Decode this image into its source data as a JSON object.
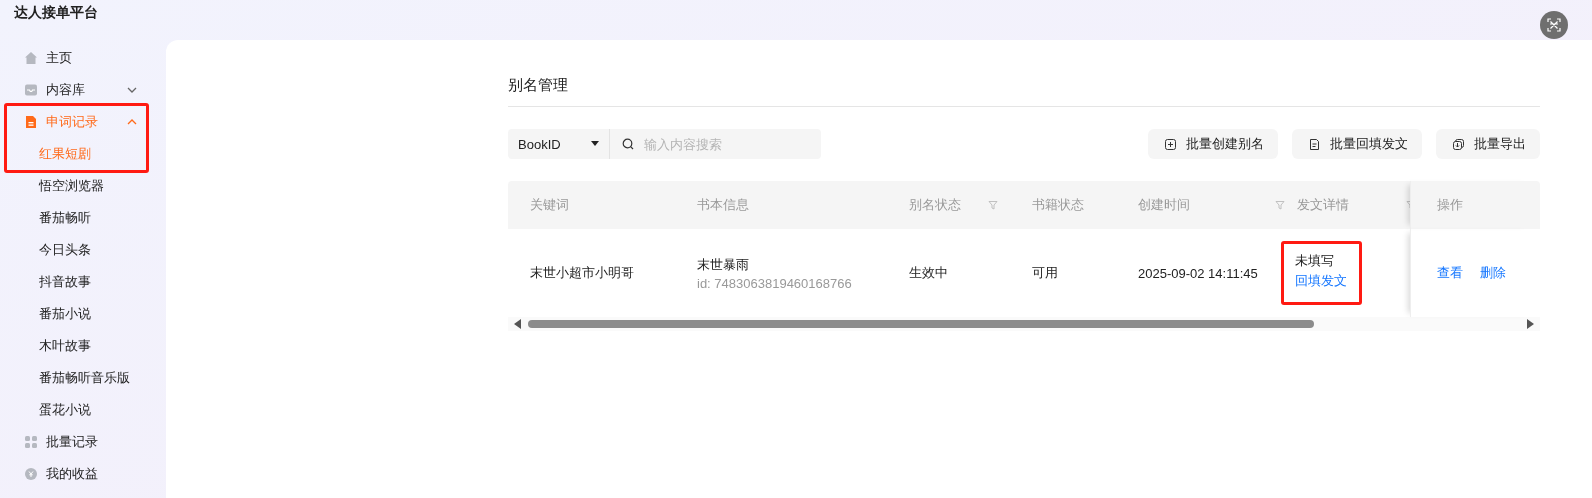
{
  "app_title": "达人接单平台",
  "sidebar": {
    "items": [
      {
        "kind": "link",
        "label": "主页",
        "selected": false
      },
      {
        "kind": "group",
        "label": "内容库",
        "expanded": false,
        "selected": false,
        "highlighted": false
      },
      {
        "kind": "group",
        "label": "申词记录",
        "expanded": true,
        "selected": true,
        "highlighted": true,
        "children": [
          {
            "label": "红果短剧",
            "selected": true
          },
          {
            "label": "悟空浏览器",
            "selected": false
          },
          {
            "label": "番茄畅听",
            "selected": false
          },
          {
            "label": "今日头条",
            "selected": false
          },
          {
            "label": "抖音故事",
            "selected": false
          },
          {
            "label": "番茄小说",
            "selected": false
          },
          {
            "label": "木叶故事",
            "selected": false
          },
          {
            "label": "番茄畅听音乐版",
            "selected": false
          },
          {
            "label": "蛋花小说",
            "selected": false
          }
        ]
      },
      {
        "kind": "link",
        "label": "批量记录",
        "selected": false
      },
      {
        "kind": "link",
        "label": "我的收益",
        "selected": false
      }
    ]
  },
  "page_title": "别名管理",
  "search": {
    "field_type": "BookID",
    "placeholder": "输入内容搜索"
  },
  "actions": [
    {
      "label": "批量创建别名"
    },
    {
      "label": "批量回填发文"
    },
    {
      "label": "批量导出"
    }
  ],
  "table": {
    "columns": [
      {
        "label": "关键词",
        "filter": false
      },
      {
        "label": "书本信息",
        "filter": false
      },
      {
        "label": "别名状态",
        "filter": true
      },
      {
        "label": "书籍状态",
        "filter": false
      },
      {
        "label": "创建时间",
        "filter": true
      },
      {
        "label": "发文详情",
        "filter": true
      },
      {
        "label": "操作",
        "filter": false
      }
    ],
    "rows": [
      {
        "keyword": "末世小超市小明哥",
        "book_title": "末世暴雨",
        "book_id": "id: 7483063819460168766",
        "alias_status": "生效中",
        "book_status": "可用",
        "created": "2025-09-02 14:11:45",
        "post_status": "未填写",
        "post_link": "回填发文",
        "post_highlighted": true,
        "actions": [
          "查看",
          "删除"
        ]
      }
    ]
  }
}
